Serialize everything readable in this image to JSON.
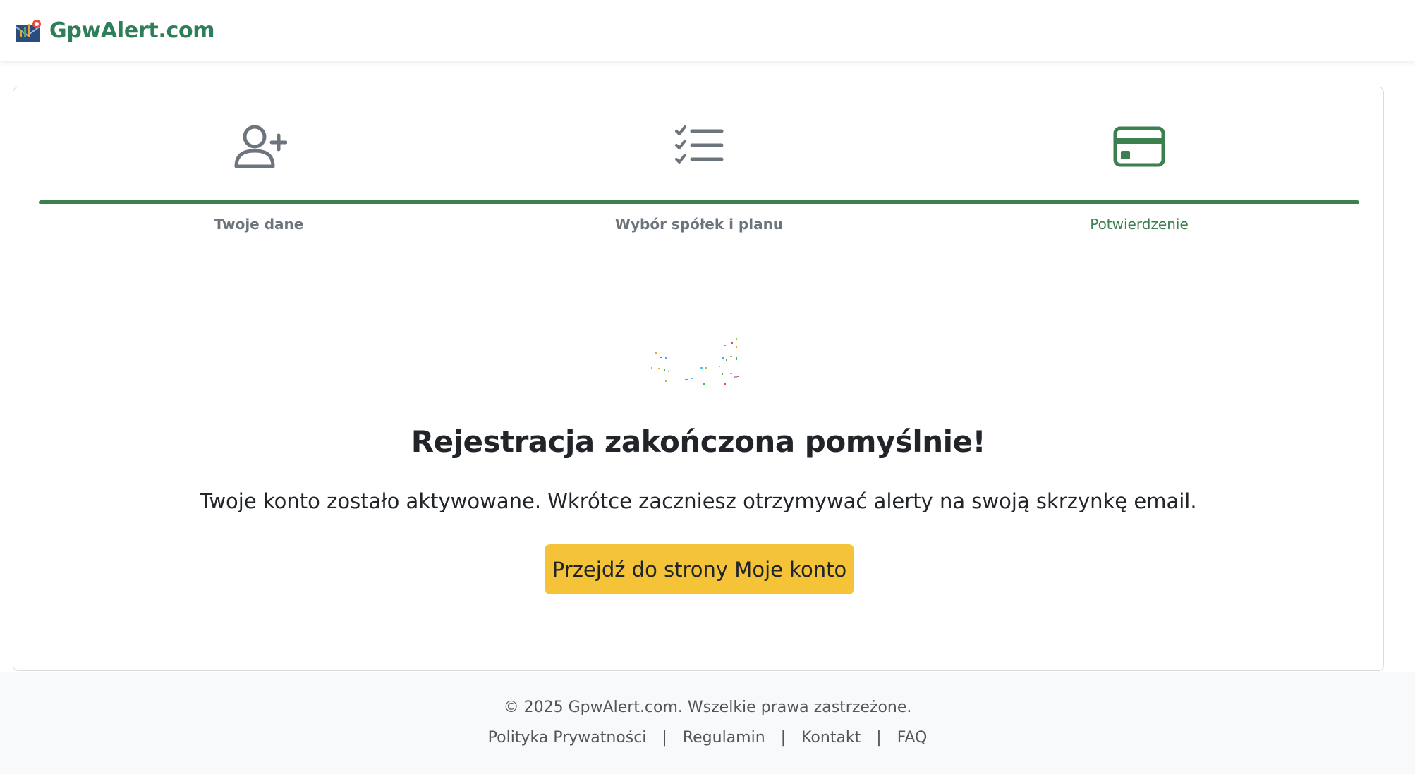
{
  "brand": {
    "name": "GpwAlert.com",
    "logo_icon": "envelope-chart-icon"
  },
  "stepper": {
    "steps": [
      {
        "label": "Twoje dane",
        "icon": "user-plus-icon",
        "active": false
      },
      {
        "label": "Wybór spółek i planu",
        "icon": "checklist-icon",
        "active": false
      },
      {
        "label": "Potwierdzenie",
        "icon": "credit-card-icon",
        "active": true
      }
    ],
    "colors": {
      "active": "#3d7f4e",
      "inactive": "#6c757d"
    }
  },
  "success": {
    "title": "Rejestracja zakończona pomyślnie!",
    "message": "Twoje konto zostało aktywowane. Wkrótce zaczniesz otrzymywać alerty na swoją skrzynkę email.",
    "button_label": "Przejdź do strony Moje konto",
    "button_color": "#f4c338"
  },
  "footer": {
    "copyright": "© 2025 GpwAlert.com. Wszelkie prawa zastrzeżone.",
    "links": [
      "Polityka Prywatności",
      "Regulamin",
      "Kontakt",
      "FAQ"
    ],
    "separator": "|"
  }
}
